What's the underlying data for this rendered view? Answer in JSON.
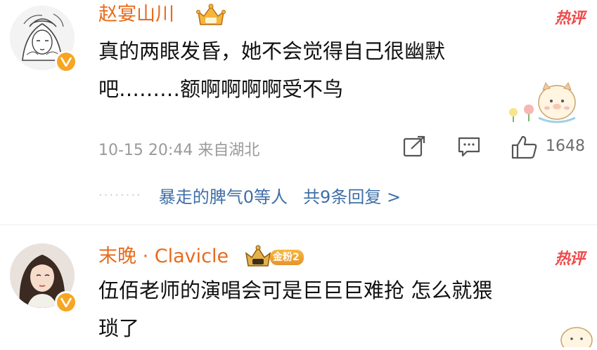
{
  "comments": [
    {
      "username": "赵宴山川",
      "hot_label": "热评",
      "text_lines": [
        "真的两眼发昏，她不会觉得自己很幽默",
        "吧………额啊啊啊啊受不鸟"
      ],
      "time": "10-15 20:44",
      "location": "来自湖北",
      "like_count": "1648",
      "reply_dots": "········",
      "reply_user": "暴走的脾气0等人",
      "reply_more": "共9条回复 >"
    },
    {
      "username": "末晚 · Clavicle",
      "fan_badge": "金粉2",
      "hot_label": "热评",
      "text_lines": [
        "伍佰老师的演唱会可是巨巨巨难抢 怎么就猥",
        "琐了"
      ]
    }
  ],
  "colors": {
    "username": "#e86b1d",
    "hot": "#ef4a4a",
    "link": "#3f6fa7",
    "meta": "#9a9a9a",
    "verified": "#f6a623"
  }
}
